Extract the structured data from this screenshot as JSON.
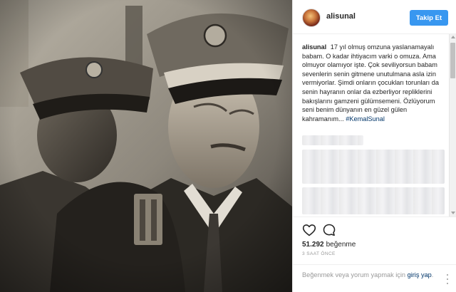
{
  "post": {
    "photo_alt": "Siyah-beyaz fotoğraf: askeri kasketli iki adam"
  },
  "header": {
    "username": "alisunal",
    "follow_label": "Takip Et"
  },
  "caption": {
    "username": "alisunal",
    "text": "17 yıl olmuş omzuna yaslanamayalı babam. O kadar ihtiyacım varki o omuza. Ama olmuyor olamıyor işte. Çok seviliyorsun babam sevenlerin senin gitmene unutulmana asla izin vermiyorlar. Şimdi onların çocukları torunları da senin hayranın onlar da ezberliyor repliklerini bakışlarını gamzeni gülümsemeni. Özlüyorum seni benim dünyanın en güzel gülen kahramanım...",
    "hashtag": "#KemalSunal"
  },
  "actions": {
    "like_icon": "heart-icon",
    "comment_icon": "comment-icon",
    "likes_count": "51.292",
    "likes_label": "beğenme",
    "time": "3 SAAT ÖNCE"
  },
  "add_comment": {
    "prefix": "Beğenmek veya yorum yapmak için ",
    "login_link": "giriş yap",
    "suffix": "."
  },
  "colors": {
    "accent": "#3897f0",
    "link": "#003569",
    "muted": "#999999"
  }
}
